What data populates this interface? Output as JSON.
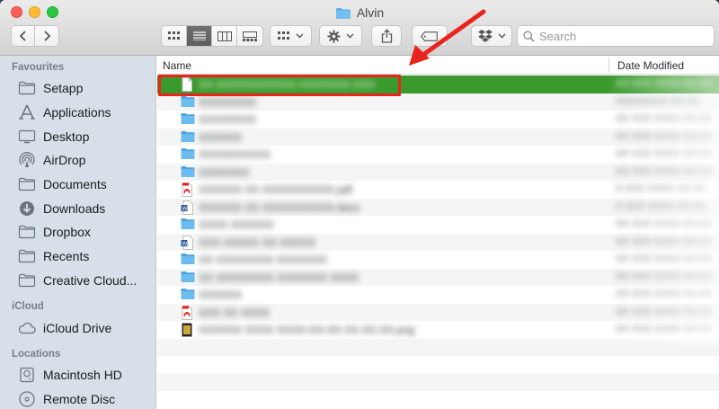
{
  "window": {
    "title": "Alvin"
  },
  "toolbar": {
    "search_placeholder": "Search"
  },
  "sidebar": {
    "sections": [
      {
        "header": "Favourites",
        "items": [
          {
            "label": "Setapp",
            "icon": "folder-icon"
          },
          {
            "label": "Applications",
            "icon": "applications-icon"
          },
          {
            "label": "Desktop",
            "icon": "desktop-icon"
          },
          {
            "label": "AirDrop",
            "icon": "airdrop-icon"
          },
          {
            "label": "Documents",
            "icon": "documents-icon"
          },
          {
            "label": "Downloads",
            "icon": "downloads-icon"
          },
          {
            "label": "Dropbox",
            "icon": "folder-icon"
          },
          {
            "label": "Recents",
            "icon": "recents-icon"
          },
          {
            "label": "Creative Cloud...",
            "icon": "folder-icon"
          }
        ]
      },
      {
        "header": "iCloud",
        "items": [
          {
            "label": "iCloud Drive",
            "icon": "cloud-icon"
          }
        ]
      },
      {
        "header": "Locations",
        "items": [
          {
            "label": "Macintosh HD",
            "icon": "hard-drive-icon"
          },
          {
            "label": "Remote Disc",
            "icon": "disc-icon"
          }
        ]
      }
    ]
  },
  "list": {
    "columns": {
      "name": "Name",
      "date": "Date Modified"
    },
    "rows": [
      {
        "type": "document",
        "name": "XX-XXXXXXXXXXX-XXXXXXX-XXX",
        "date": "XX XXX XXXX XX:XX",
        "selected": true
      },
      {
        "type": "folder",
        "name": "XXXXXXXX",
        "date": "XXXXXXXX XX:XX"
      },
      {
        "type": "folder",
        "name": "XXXXXXXX",
        "date": "XX XXX XXXX XX:XX"
      },
      {
        "type": "folder",
        "name": "XXXXXX",
        "date": "XX XXX XXXX XX:XX"
      },
      {
        "type": "folder",
        "name": "XXXXXXXXXX",
        "date": "XX XXX XXXX XX:XX"
      },
      {
        "type": "folder",
        "name": "XXXXXXX",
        "date": "XX XXX XXXX XX:XX"
      },
      {
        "type": "pdf",
        "name": "XXXXXX XX XXXXXXXXXX.pdf",
        "date": "X XXX XXXX XX:XX"
      },
      {
        "type": "word",
        "name": "XXXXXX XX XXXXXXXXXX.docx",
        "date": "X XXX XXXX XX:XX"
      },
      {
        "type": "folder",
        "name": "XXXX XXXXXX",
        "date": "XX XXX XXXX XX:XX"
      },
      {
        "type": "word",
        "name": "XXX XXXXX XX XXXXX",
        "date": "XX XXX XXXX XX:XX"
      },
      {
        "type": "folder",
        "name": "XX XXXXXXXX XXXXXXX",
        "date": "XX XXX XXXX XX:XX"
      },
      {
        "type": "folder",
        "name": "XX XXXXXXXX XXXXXXX XXXX",
        "date": "XX XXX XXXX XX:XX"
      },
      {
        "type": "folder",
        "name": "XXXXXX",
        "date": "XX XXX XXXX XX:XX"
      },
      {
        "type": "pdf",
        "name": "XXX XX XXXX",
        "date": "XX XXX XXXX XX:XX"
      },
      {
        "type": "image",
        "name": "XXXXXX XXXX XXXX-XX-XX XX.XX.XX.png",
        "date": "XX XXX XXXX XX:XX"
      },
      {
        "type": "empty",
        "name": "",
        "date": ""
      },
      {
        "type": "empty",
        "name": "",
        "date": ""
      },
      {
        "type": "empty",
        "name": "",
        "date": ""
      }
    ]
  },
  "colors": {
    "selection": "#3b9a2d",
    "annotation": "#e8241c",
    "folder": "#5ab0e8"
  }
}
